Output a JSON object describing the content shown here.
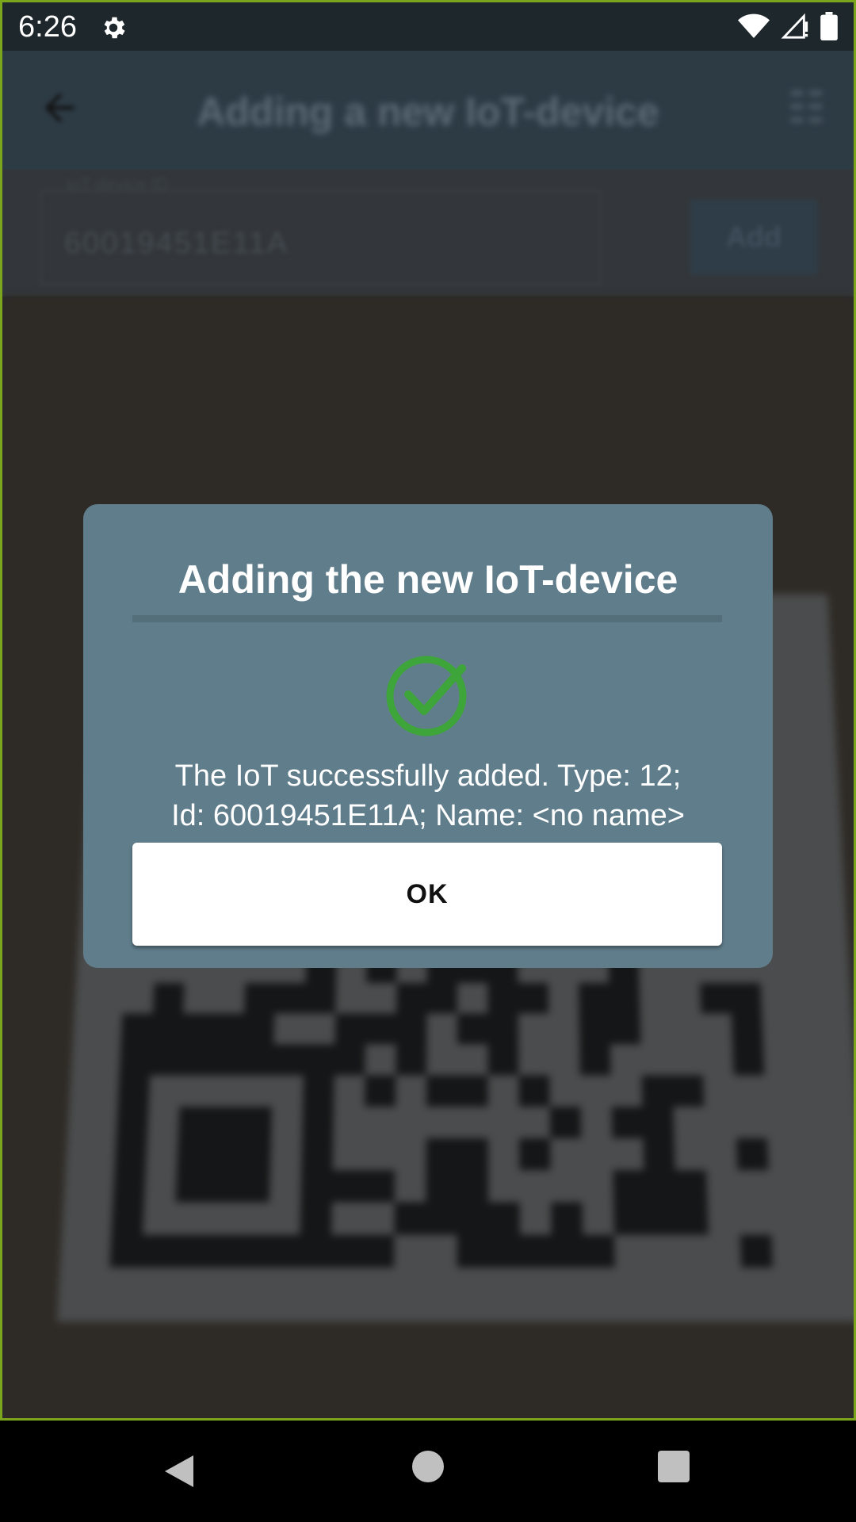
{
  "status_bar": {
    "time": "6:26",
    "icons": [
      "settings-gear-icon",
      "wifi-icon",
      "cell-signal-no-data-icon",
      "battery-icon"
    ]
  },
  "app": {
    "header": {
      "title": "Adding a new IoT-device",
      "back_icon": "arrow-back-icon",
      "action_icon": "flashlight-icon"
    },
    "input": {
      "label": "IoT-device ID",
      "value": "60019451E11A"
    },
    "add_button_label": "Add"
  },
  "dialog": {
    "title": "Adding the new IoT-device",
    "status_icon": "check-circle-icon",
    "message_line1": "The IoT successfully added. Type: 12;",
    "message_line2": "Id: 60019451E11A; Name: <no name>",
    "ok_label": "OK",
    "colors": {
      "background": "#607d8b",
      "divider": "#546e7a",
      "success": "#3ea53a"
    }
  },
  "nav_bar": {
    "icons": [
      "nav-back-icon",
      "nav-home-icon",
      "nav-recents-icon"
    ]
  }
}
